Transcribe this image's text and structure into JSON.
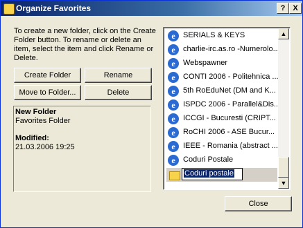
{
  "window": {
    "title": "Organize Favorites",
    "help_label": "?",
    "close_label": "X"
  },
  "instructions": "To create a new folder, click on the Create Folder button. To rename or delete an item, select the item and click Rename or Delete.",
  "buttons": {
    "create_folder": "Create Folder",
    "rename": "Rename",
    "move_to_folder": "Move to Folder...",
    "delete": "Delete",
    "close": "Close"
  },
  "info": {
    "name": "New Folder",
    "type": "Favorites Folder",
    "modified_label": "Modified:",
    "modified_value": "21.03.2006 19:25"
  },
  "favorites": [
    {
      "label": "SERIALS & KEYS",
      "icon": "ie-icon"
    },
    {
      "label": "charlie-irc.as.ro -Numerolo...",
      "icon": "ie-icon"
    },
    {
      "label": "Webspawner",
      "icon": "ie-icon"
    },
    {
      "label": "CONTI 2006 - Politehnica ...",
      "icon": "ie-icon"
    },
    {
      "label": "5th RoEduNet (DM and K...",
      "icon": "ie-icon"
    },
    {
      "label": "ISPDC 2006 - Parallel&Dis...",
      "icon": "ie-icon"
    },
    {
      "label": "ICCGI - Bucuresti (CRIPT...",
      "icon": "ie-icon"
    },
    {
      "label": "RoCHI 2006 - ASE Bucur...",
      "icon": "ie-icon"
    },
    {
      "label": "IEEE - Romania (abstract ...",
      "icon": "ie-icon"
    },
    {
      "label": "Coduri Postale",
      "icon": "ie-icon"
    }
  ],
  "editing_item": {
    "value": "Coduri postale",
    "icon": "folder-icon"
  },
  "scrollbar": {
    "up": "▲",
    "down": "▼"
  }
}
